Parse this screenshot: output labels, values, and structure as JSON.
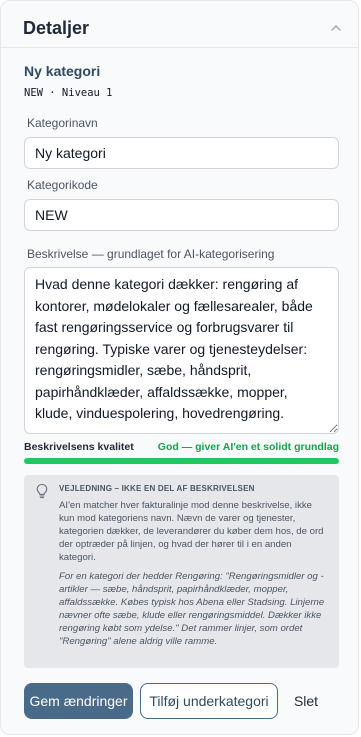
{
  "header": {
    "title": "Detaljer",
    "collapse_icon": "chevron-up-icon"
  },
  "category": {
    "title": "Ny kategori",
    "meta": "NEW · Niveau 1"
  },
  "fields": {
    "name": {
      "label": "Kategorinavn",
      "value": "Ny kategori"
    },
    "code": {
      "label": "Kategorikode",
      "value": "NEW"
    },
    "description": {
      "label": "Beskrivelse — grundlaget for AI-kategorisering",
      "value": "Hvad denne kategori dækker: rengøring af kontorer, mødelokaler og fællesarealer, både fast rengøringsservice og forbrugsvarer til rengøring. Typiske varer og tjenesteydelser: rengøringsmidler, sæbe, håndsprit, papirhåndklæder, affaldssække, mopper, klude, vinduespolering, hovedrengøring."
    }
  },
  "quality": {
    "label": "Beskrivelsens kvalitet",
    "status": "God — giver AI'en et solidt grundlag",
    "level_percent": 100,
    "color": "#22c55e"
  },
  "guidance": {
    "icon": "lightbulb-icon",
    "heading": "VEJLEDNING – IKKE EN DEL AF BESKRIVELSEN",
    "body": "AI'en matcher hver fakturalinje mod denne beskrivelse, ikke kun mod kategoriens navn. Nævn de varer og tjenester, kategorien dækker, de leverandører du køber dem hos, de ord der optræder på linjen, og hvad der hører til i en anden kategori.",
    "example": "For en kategori der hedder Rengøring: \"Rengøringsmidler og -artikler — sæbe, håndsprit, papirhåndklæder, mopper, affaldssække. Købes typisk hos Abena eller Stadsing. Linjerne nævner ofte sæbe, klude eller rengøringsmiddel. Dækker ikke rengøring købt som ydelse.\" Det rammer linjer, som ordet \"Rengøring\" alene aldrig ville ramme."
  },
  "actions": {
    "save": "Gem ændringer",
    "add_sub": "Tilføj underkategori",
    "delete": "Slet"
  },
  "colors": {
    "primary": "#4a6a8a",
    "success": "#16a34a"
  }
}
